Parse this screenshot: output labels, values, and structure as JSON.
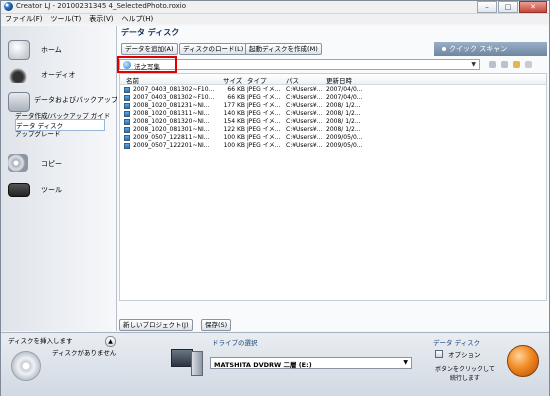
{
  "window": {
    "title": "Creator LJ - 20100231345 4_SelectedPhoto.roxio",
    "buttons": [
      "–",
      "□",
      "✕"
    ]
  },
  "menu": [
    "ファイル(F)",
    "ツール(T)",
    "表示(V)",
    "ヘルプ(H)"
  ],
  "sidebar": {
    "items": [
      {
        "label": "ホーム",
        "icon": "home-icon"
      },
      {
        "label": "オーディオ",
        "icon": "headphones-icon"
      },
      {
        "label": "データおよびバックアップ",
        "icon": "folder-icon"
      },
      {
        "label": "コピー",
        "icon": "copy-discs-icon"
      },
      {
        "label": "ツール",
        "icon": "toolbox-icon"
      }
    ],
    "sub_items": [
      "データ作成/バックアップ ガイド",
      "データ ディスク",
      "アップグレード"
    ]
  },
  "main": {
    "title": "データ ディスク",
    "buttons": [
      "データを追加(A)",
      "ディスクのロード(L)",
      "起動ディスクを作成(M)"
    ],
    "quick_scan": "クイック スキャン",
    "path": "法之写集",
    "columns": [
      "名前",
      "サイズ",
      "タイプ",
      "パス",
      "更新日時"
    ],
    "rows": [
      [
        "2007_0403_081302~F10...",
        "66 KB",
        "JPEG イメ...",
        "C:¥Users¥...",
        "2007/04/0..."
      ],
      [
        "2007_0403_081302~F10...",
        "66 KB",
        "JPEG イメ...",
        "C:¥Users¥...",
        "2007/04/0..."
      ],
      [
        "2008_1020_081231~NI...",
        "177 KB",
        "JPEG イメ...",
        "C:¥Users¥...",
        "2008/ 1/2..."
      ],
      [
        "2008_1020_081311~NI...",
        "140 KB",
        "JPEG イメ...",
        "C:¥Users¥...",
        "2008/ 1/2..."
      ],
      [
        "2008_1020_081320~NI...",
        "154 KB",
        "JPEG イメ...",
        "C:¥Users¥...",
        "2008/ 1/2..."
      ],
      [
        "2008_1020_081301~NI...",
        "122 KB",
        "JPEG イメ...",
        "C:¥Users¥...",
        "2008/ 1/2..."
      ],
      [
        "2009_0507_122811~NI...",
        "100 KB",
        "JPEG イメ...",
        "C:¥Users¥...",
        "2009/05/0..."
      ],
      [
        "2009_0507_122201~NI...",
        "100 KB",
        "JPEG イメ...",
        "C:¥Users¥...",
        "2009/05/0..."
      ]
    ],
    "bottom_buttons": [
      "新しいプロジェクト(J)",
      "保存(S)"
    ]
  },
  "footer": {
    "insert_disc": "ディスクを挿入します",
    "no_disc": "ディスクがありません",
    "drive_select_label": "ドライブの選択",
    "drive": "MATSHITA DVDRW 二層 (E:)",
    "data_disc": "データ ディスク",
    "option": "オプション",
    "hint": "ボタンをクリックして\n続行します",
    "collapse": "▲"
  },
  "colors": {
    "highlight": "#e00000",
    "burn": "#f08a22",
    "accent": "#1b4478"
  }
}
